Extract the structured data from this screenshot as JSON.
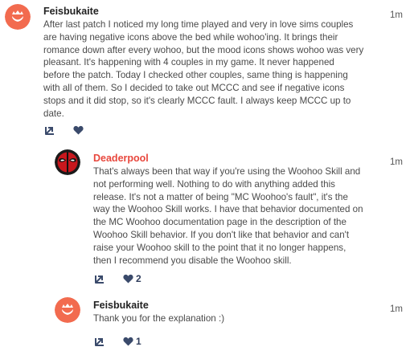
{
  "colors": {
    "author_default": "#222222",
    "author_highlight": "#e8473d",
    "avatar_orange": "#f26b4f",
    "icon": "#3a4a6b"
  },
  "comments": [
    {
      "author": "Feisbukaite",
      "avatar_icon": "default-orange-avatar-icon",
      "time": "1m",
      "body": [
        "After last patch I noticed my long time played and very in love sims couples",
        "are having negative icons above the bed while wohoo'ing. It brings their",
        "romance down after every wohoo, but the mood icons shows wohoo was very",
        "pleasant. It's happening with 4 couples in my game. It never happened",
        "before the patch. Today I checked other couples, same thing is happening",
        "with all of them. So I decided to take out MCCC and see if negative icons",
        "stops and it did stop, so it's clearly MCCC fault.  I always keep MCCC up to",
        "date."
      ],
      "likes": ""
    },
    {
      "author": "Deaderpool",
      "avatar_icon": "deadpool-mask-avatar-icon",
      "time": "1m",
      "body": [
        "That's always been that way if you're using the Woohoo Skill and",
        "not performing well.  Nothing to do with anything added this",
        "release.  It's not a matter of being \"MC Woohoo's fault\", it's the",
        "way the Woohoo Skill works.  I have that behavior documented on",
        "the MC Woohoo documentation page in the description of the",
        "Woohoo Skill behavior.  If you don't like that behavior and can't",
        "raise your Woohoo skill to the point that it no longer happens,",
        "then I recommend you disable the Woohoo skill."
      ],
      "likes": "2"
    },
    {
      "author": "Feisbukaite",
      "avatar_icon": "default-orange-avatar-icon",
      "time": "1m",
      "body": [
        "Thank you for the explanation :)"
      ],
      "likes": "1"
    }
  ]
}
